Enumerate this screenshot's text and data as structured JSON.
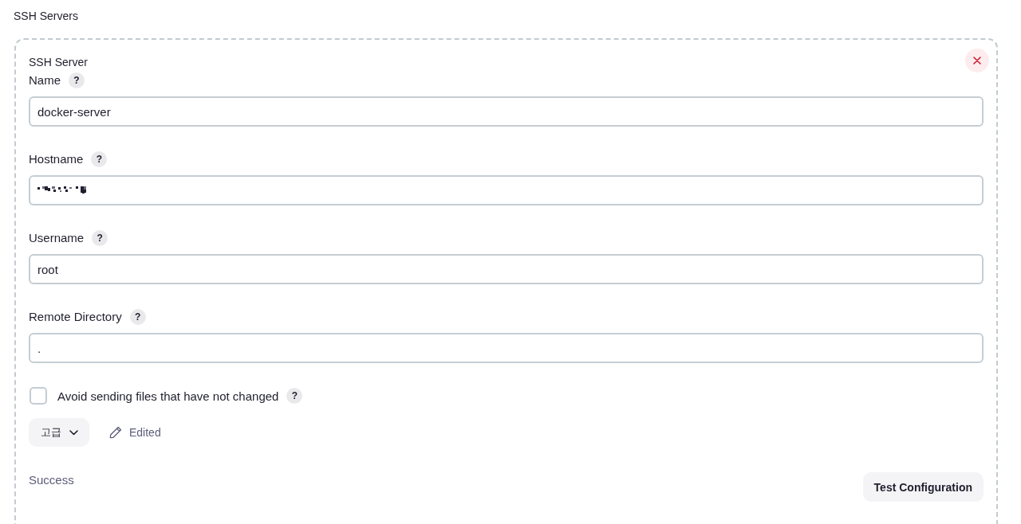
{
  "section_title": "SSH Servers",
  "server": {
    "title": "SSH Server",
    "fields": [
      {
        "kind": "text",
        "label": "Name",
        "help": "?",
        "value": "docker-server"
      },
      {
        "kind": "redacted",
        "label": "Hostname",
        "help": "?"
      },
      {
        "kind": "text",
        "label": "Username",
        "help": "?",
        "value": "root"
      },
      {
        "kind": "text",
        "label": "Remote Directory",
        "help": "?",
        "value": "."
      }
    ],
    "checkbox": {
      "label": "Avoid sending files that have not changed",
      "help": "?",
      "checked": false
    },
    "advanced": {
      "label": "고급",
      "expanded": false
    },
    "edited": "Edited",
    "status": "Success",
    "test_button": "Test Configuration"
  }
}
